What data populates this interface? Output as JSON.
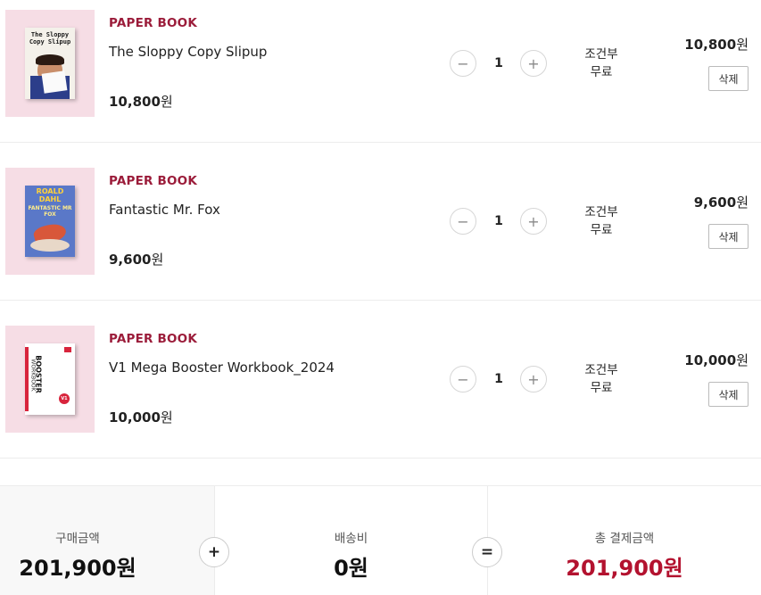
{
  "cart": {
    "items": [
      {
        "category": "PAPER BOOK",
        "title": "The Sloppy Copy Slipup",
        "unit_price": "10,800",
        "currency": "원",
        "quantity": "1",
        "shipping_line1": "조건부",
        "shipping_line2": "무료",
        "line_price": "10,800",
        "delete_label": "삭제",
        "cover_text": "The Sloppy Copy Slipup"
      },
      {
        "category": "PAPER BOOK",
        "title": "Fantastic Mr. Fox",
        "unit_price": "9,600",
        "currency": "원",
        "quantity": "1",
        "shipping_line1": "조건부",
        "shipping_line2": "무료",
        "line_price": "9,600",
        "delete_label": "삭제",
        "cover_text_1": "ROALD DAHL",
        "cover_text_2": "FANTASTIC MR FOX"
      },
      {
        "category": "PAPER BOOK",
        "title": "V1 Mega Booster Workbook_2024",
        "unit_price": "10,000",
        "currency": "원",
        "quantity": "1",
        "shipping_line1": "조건부",
        "shipping_line2": "무료",
        "line_price": "10,000",
        "delete_label": "삭제",
        "cover_text_1": "BOOSTER",
        "cover_text_2": "WORKBOOK",
        "cover_badge": "V1"
      }
    ]
  },
  "icons": {
    "minus": "−",
    "plus": "+",
    "equals": "="
  },
  "summary": {
    "purchase_label": "구매금액",
    "purchase_value": "201,900원",
    "shipping_label": "배송비",
    "shipping_value": "0원",
    "total_label": "총 결제금액",
    "total_value": "201,900원"
  },
  "colors": {
    "accent": "#9b1c3a",
    "total": "#b3122f",
    "thumb_bg": "#f6dde5"
  }
}
